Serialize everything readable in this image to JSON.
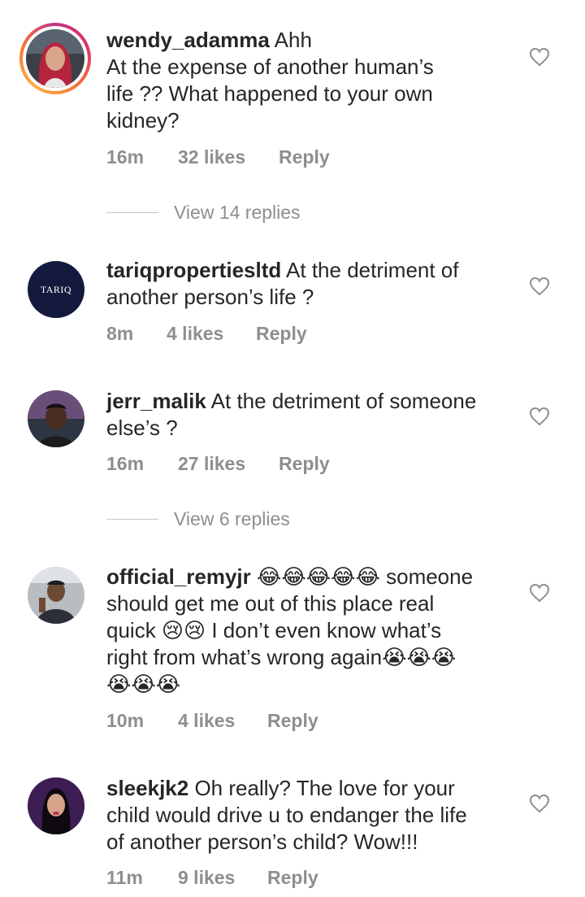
{
  "comments": [
    {
      "username": "wendy_adamma",
      "text_lines": [
        "Ahh",
        "At the expense of another human’s",
        "life ?? What happened to your own",
        "kidney?"
      ],
      "time": "16m",
      "likes": "32 likes",
      "reply": "Reply",
      "view_replies": "View 14 replies",
      "avatar_icon": "profile-photo"
    },
    {
      "username": "tariqpropertiesltd",
      "text_lines": [
        "At the detriment of",
        "another person’s life ?"
      ],
      "time": "8m",
      "likes": "4 likes",
      "reply": "Reply",
      "avatar_label": "TARIQ",
      "avatar_icon": "brand-logo"
    },
    {
      "username": "jerr_malik",
      "text_lines": [
        "At the detriment of someone",
        "else’s ?"
      ],
      "time": "16m",
      "likes": "27 likes",
      "reply": "Reply",
      "view_replies": "View 6 replies",
      "avatar_icon": "profile-photo"
    },
    {
      "username": "official_remyjr",
      "text_lines": [
        "😂😂😂😂😂 someone",
        "should get me out of this place real",
        "quick 😢😢 I don’t even know what’s",
        "right from what’s wrong again😭😭😭",
        "😭😭😭"
      ],
      "time": "10m",
      "likes": "4 likes",
      "reply": "Reply",
      "avatar_icon": "profile-photo"
    },
    {
      "username": "sleekjk2",
      "text_lines": [
        "Oh really? The love for your",
        "child would drive u to endanger the life",
        "of another person’s child? Wow!!!"
      ],
      "time": "11m",
      "likes": "9 likes",
      "reply": "Reply",
      "avatar_icon": "profile-photo"
    }
  ],
  "colors": {
    "text": "#262626",
    "muted": "#8e8e8e",
    "divider": "#c7c7c7",
    "ring_gradient": [
      "#c13584",
      "#e1306c",
      "#f77737",
      "#fcaf45"
    ],
    "tariq_avatar_bg": "#141a3e"
  },
  "icons": {
    "like": "heart-outline-icon"
  }
}
